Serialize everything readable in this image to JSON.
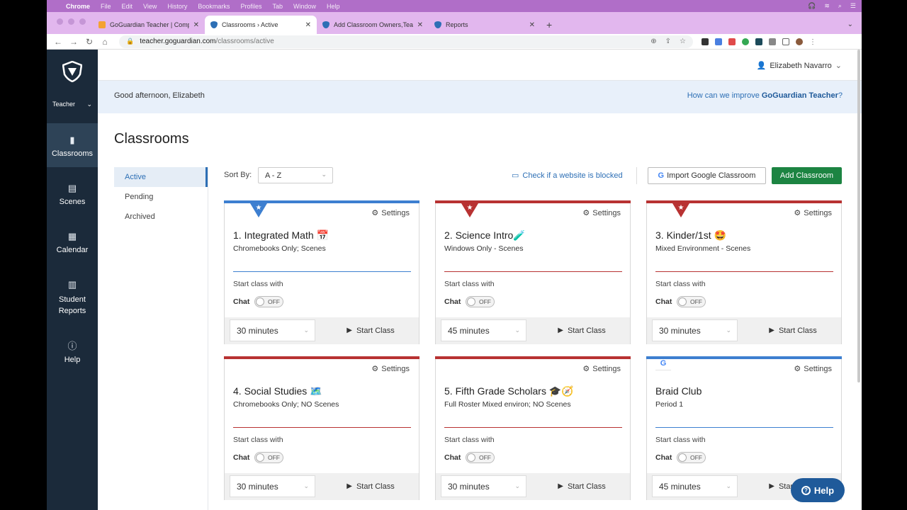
{
  "mac_menu": [
    "Chrome",
    "File",
    "Edit",
    "View",
    "History",
    "Bookmarks",
    "Profiles",
    "Tab",
    "Window",
    "Help"
  ],
  "tabs": [
    {
      "title": "GoGuardian Teacher | Compre",
      "fav": "#f4a233"
    },
    {
      "title": "Classrooms › Active",
      "fav": "#2d6fb5"
    },
    {
      "title": "Add Classroom Owners,Teache",
      "fav": "#2d6fb5"
    },
    {
      "title": "Reports",
      "fav": "#2d6fb5"
    }
  ],
  "url": {
    "host": "teacher.goguardian.com",
    "path": "/classrooms/active"
  },
  "sidebar": {
    "role": "Teacher",
    "items": [
      {
        "label": "Classrooms",
        "icon": "book-icon"
      },
      {
        "label": "Scenes",
        "icon": "scenes-icon"
      },
      {
        "label": "Calendar",
        "icon": "calendar-icon"
      },
      {
        "label": "Student Reports",
        "icon": "bar-chart-icon"
      },
      {
        "label": "Help",
        "icon": "help-icon"
      }
    ]
  },
  "user": {
    "name": "Elizabeth Navarro"
  },
  "greeting": {
    "text": "Good afternoon, Elizabeth",
    "feedback_prefix": "How can we improve ",
    "feedback_brand": "GoGuardian Teacher",
    "feedback_suffix": "?"
  },
  "page": {
    "title": "Classrooms"
  },
  "subnav": [
    "Active",
    "Pending",
    "Archived"
  ],
  "toolbar": {
    "sort_label": "Sort By:",
    "sort_value": "A - Z",
    "check_link": "Check if a website is blocked",
    "import_label": "Import Google Classroom",
    "add_label": "Add Classroom"
  },
  "card_labels": {
    "settings": "Settings",
    "start_with": "Start class with",
    "chat": "Chat",
    "toggle": "OFF",
    "start": "Start Class"
  },
  "classrooms": [
    {
      "name": "1. Integrated Math 📅",
      "desc": "Chromebooks Only; Scenes",
      "duration": "30 minutes",
      "accent": "#3d7fd0",
      "badge": "star"
    },
    {
      "name": "2. Science Intro🧪",
      "desc": "Windows Only - Scenes",
      "duration": "45 minutes",
      "accent": "#b83232",
      "badge": "star"
    },
    {
      "name": "3. Kinder/1st 🤩",
      "desc": "Mixed Environment - Scenes",
      "duration": "30 minutes",
      "accent": "#b83232",
      "badge": "star"
    },
    {
      "name": "4. Social Studies 🗺️",
      "desc": "Chromebooks Only; NO Scenes",
      "duration": "30 minutes",
      "accent": "#b83232",
      "badge": "none"
    },
    {
      "name": "5. Fifth Grade Scholars 🎓🧭",
      "desc": "Full Roster Mixed environ; NO Scenes",
      "duration": "30 minutes",
      "accent": "#b83232",
      "badge": "none"
    },
    {
      "name": "Braid Club",
      "desc": "Period 1",
      "duration": "45 minutes",
      "accent": "#3d7fd0",
      "badge": "google"
    }
  ],
  "help_widget": {
    "label": "Help"
  }
}
